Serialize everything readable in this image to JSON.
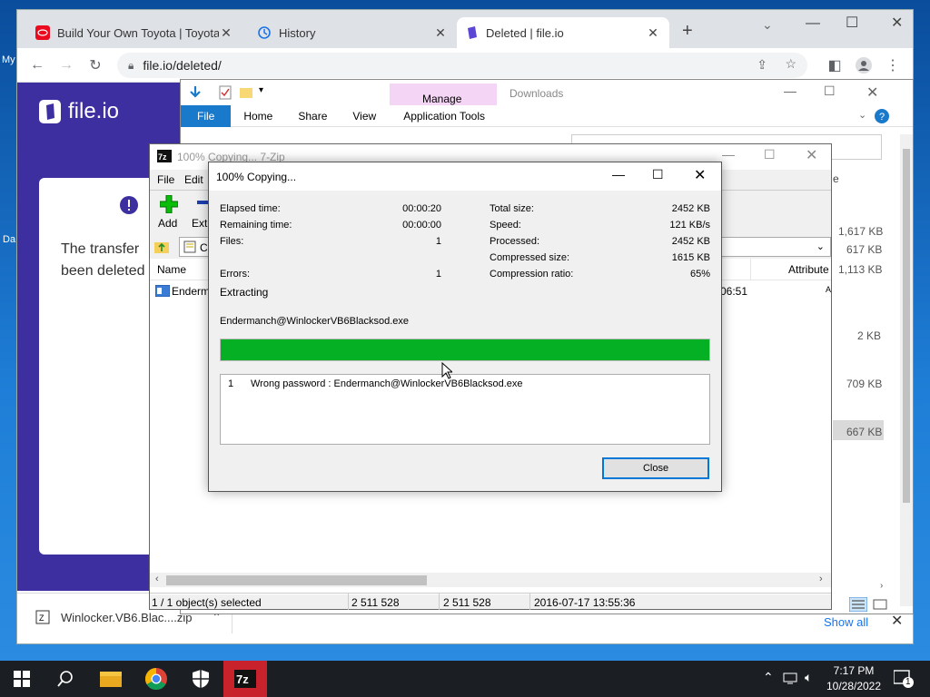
{
  "desktop": {
    "label_top": "My",
    "label_bottom": "Da"
  },
  "browser": {
    "tabs": [
      {
        "title": "Build Your Own Toyota | Toyota C",
        "icon": "toyota-icon"
      },
      {
        "title": "History",
        "icon": "history-icon"
      },
      {
        "title": "Deleted | file.io",
        "icon": "fileio-icon"
      }
    ],
    "url": "file.io/deleted/",
    "page": {
      "brand": "file.io",
      "card_text_1": "The transfer",
      "card_text_2": "been deleted"
    },
    "download": {
      "filename": "Winlocker.VB6.Blac....zip",
      "show_all": "Show all"
    }
  },
  "explorer": {
    "title": "Downloads",
    "manage": "Manage",
    "tabs": [
      "File",
      "Home",
      "Share",
      "View",
      "Application Tools"
    ],
    "sizes": [
      "1,617 KB",
      "617 KB",
      "1,113 KB",
      "2 KB",
      "709 KB",
      "667 KB"
    ],
    "partial_header": "e"
  },
  "sevenzip": {
    "title": "100% Copying... 7-Zip",
    "menu": [
      "File",
      "Edit"
    ],
    "toolbar": [
      "Add",
      "Extr"
    ],
    "path_partial": "C",
    "columns": {
      "name": "Name",
      "attributes": "Attribute"
    },
    "row": {
      "name": "Enderm",
      "time": "06:51",
      "attr": "A"
    },
    "status": {
      "selected": "1 / 1 object(s) selected",
      "size": "2 511 528",
      "packed": "2 511 528",
      "date": "2016-07-17 13:55:36"
    }
  },
  "dialog": {
    "title": "100% Copying...",
    "left": [
      {
        "label": "Elapsed time:",
        "value": "00:00:20"
      },
      {
        "label": "Remaining time:",
        "value": "00:00:00"
      },
      {
        "label": "Files:",
        "value": "1"
      },
      {
        "label": "Errors:",
        "value": "1"
      }
    ],
    "right": [
      {
        "label": "Total size:",
        "value": "2452 KB"
      },
      {
        "label": "Speed:",
        "value": "121 KB/s"
      },
      {
        "label": "Processed:",
        "value": "2452 KB"
      },
      {
        "label": "Compressed size:",
        "value": "1615 KB"
      },
      {
        "label": "Compression ratio:",
        "value": "65%"
      }
    ],
    "operation": "Extracting",
    "current_file": "Endermanch@WinlockerVB6Blacksod.exe",
    "progress": 1.0,
    "messages": [
      {
        "index": "1",
        "text": "Wrong password : Endermanch@WinlockerVB6Blacksod.exe"
      }
    ],
    "close_label": "Close"
  },
  "taskbar": {
    "time": "7:17 PM",
    "date": "10/28/2022",
    "notification_count": "1",
    "apps": [
      "start-icon",
      "search-icon",
      "file-explorer-icon",
      "chrome-icon",
      "security-icon",
      "7zip-icon"
    ]
  },
  "colors": {
    "progress": "#06b025",
    "fileio_purple": "#3d2fa0",
    "ribbon_file": "#1979ca",
    "manage_tab": "#f5d5f5"
  }
}
